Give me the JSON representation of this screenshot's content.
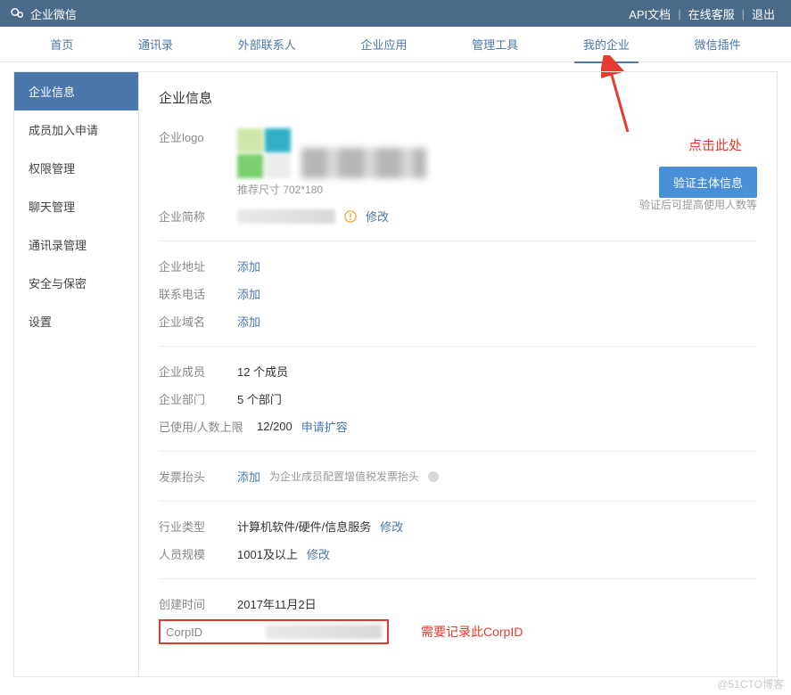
{
  "topbar": {
    "brand": "企业微信",
    "api_doc": "API文档",
    "support": "在线客服",
    "logout": "退出"
  },
  "nav": {
    "tabs": [
      "首页",
      "通讯录",
      "外部联系人",
      "企业应用",
      "管理工具",
      "我的企业",
      "微信插件"
    ],
    "active_index": 5
  },
  "sidebar": {
    "items": [
      "企业信息",
      "成员加入申请",
      "权限管理",
      "聊天管理",
      "通讯录管理",
      "安全与保密",
      "设置"
    ],
    "active_index": 0
  },
  "content": {
    "title": "企业信息",
    "logo": {
      "label": "企业logo",
      "size_hint": "推荐尺寸 702*180"
    },
    "short_name": {
      "label": "企业简称",
      "edit": "修改"
    },
    "verify_btn": "验证主体信息",
    "verify_hint": "验证后可提高使用人数等",
    "address": {
      "label": "企业地址",
      "action": "添加"
    },
    "phone": {
      "label": "联系电话",
      "action": "添加"
    },
    "domain": {
      "label": "企业域名",
      "action": "添加"
    },
    "members": {
      "label": "企业成员",
      "value": "12 个成员"
    },
    "depts": {
      "label": "企业部门",
      "value": "5 个部门"
    },
    "quota": {
      "label": "已使用/人数上限",
      "value": "12/200",
      "action": "申请扩容"
    },
    "invoice": {
      "label": "发票抬头",
      "action": "添加",
      "note": "为企业成员配置增值税发票抬头"
    },
    "industry": {
      "label": "行业类型",
      "value": "计算机软件/硬件/信息服务",
      "edit": "修改"
    },
    "scale": {
      "label": "人员规模",
      "value": "1001及以上",
      "edit": "修改"
    },
    "created": {
      "label": "创建时间",
      "value": "2017年11月2日"
    },
    "corpid": {
      "label": "CorpID"
    }
  },
  "annotations": {
    "click_here": "点击此处",
    "record_corpid": "需要记录此CorpID"
  },
  "watermark": "@51CTO博客"
}
